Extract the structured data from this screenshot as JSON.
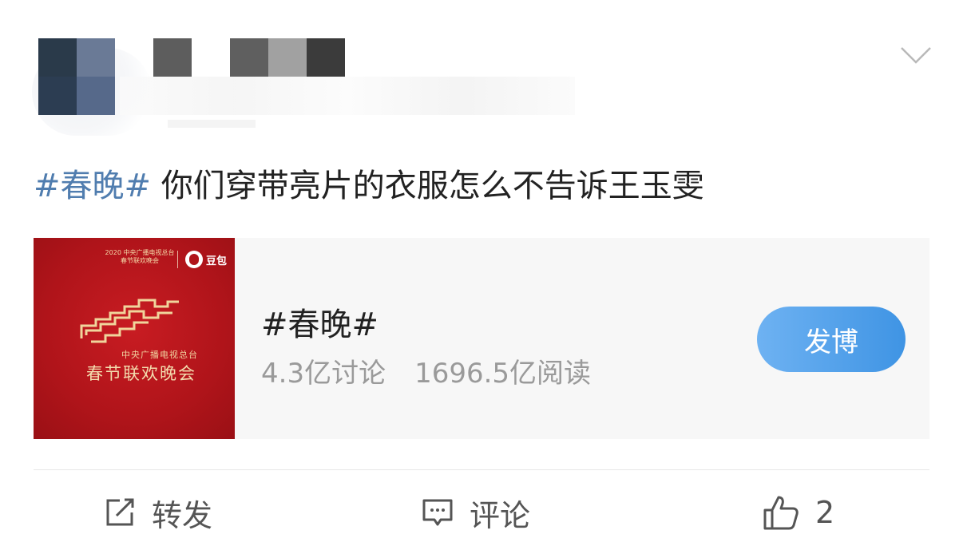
{
  "post": {
    "hashtag": "#春晚#",
    "text": " 你们穿带亮片的衣服怎么不告诉王玉雯"
  },
  "topic_card": {
    "thumbnail": {
      "top_text": "2020 中央广播电视总台 春节联欢晚会",
      "brand": "豆包",
      "line1": "中央广播电视总台",
      "line2": "春节联欢晚会"
    },
    "title": "#春晚#",
    "discussions": "4.3亿讨论",
    "reads": "1696.5亿阅读",
    "post_button": "发博"
  },
  "actions": {
    "repost": "转发",
    "comment": "评论",
    "like_count": "2"
  },
  "icons": {
    "expand": "chevron-down-icon",
    "repost": "repost-icon",
    "comment": "comment-icon",
    "like": "thumbs-up-icon"
  },
  "colors": {
    "hashtag": "#507daf",
    "button": "#4a9be8",
    "thumb_red": "#b0141a"
  }
}
